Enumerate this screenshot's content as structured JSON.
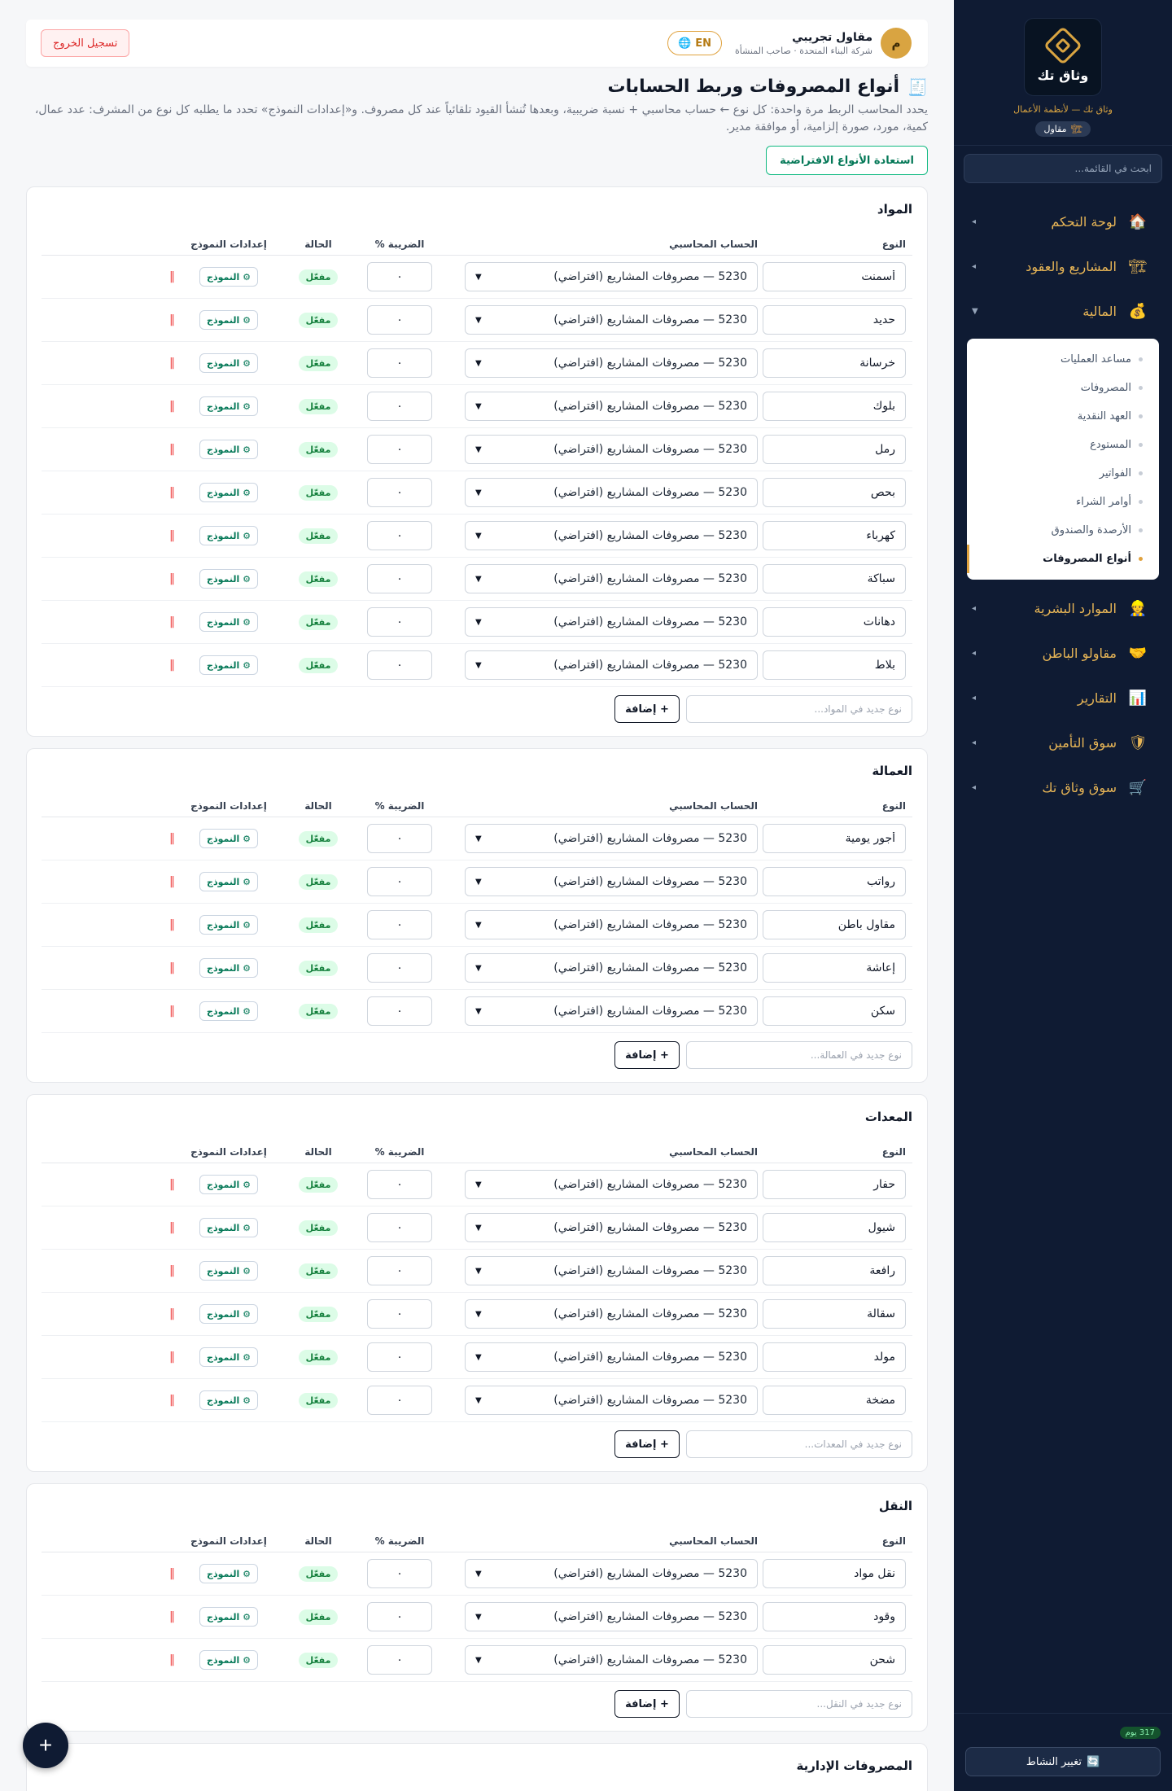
{
  "sidebar": {
    "logo_name": "وثاق تك",
    "tagline": "وثاق تك — لأنظمة الأعمال",
    "role": "مقاول",
    "search_placeholder": "ابحث في القائمة...",
    "nav": [
      {
        "label": "لوحة التحكم",
        "icon": "🏠"
      },
      {
        "label": "المشاريع والعقود",
        "icon": "🏗"
      },
      {
        "label": "المالية",
        "icon": "💰",
        "expanded": true
      },
      {
        "label": "الموارد البشرية",
        "icon": "👷"
      },
      {
        "label": "مقاولو الباطن",
        "icon": "🤝"
      },
      {
        "label": "التقارير",
        "icon": "📊"
      },
      {
        "label": "سوق التأمين",
        "icon": "🛡"
      },
      {
        "label": "سوق وثاق تك",
        "icon": "🛒"
      }
    ],
    "finance_sub": [
      "مساعد العمليات",
      "المصروفات",
      "العهد النقدية",
      "المستودع",
      "الفواتير",
      "أوامر الشراء",
      "الأرصدة والصندوق",
      "أنواع المصروفات"
    ],
    "days": "317 يوم",
    "activity_button": "تغيير النشاط"
  },
  "header": {
    "lang": "EN",
    "avatar": "م",
    "user_name": "مقاول تجريبي",
    "company": "شركة البناء المتحدة · صاحب المنشأة",
    "logout": "تسجيل الخروج"
  },
  "page": {
    "title": "أنواع المصروفات وربط الحسابات",
    "description": "يحدد المحاسب الربط مرة واحدة: كل نوع ← حساب محاسبي + نسبة ضريبية، وبعدها تُنشأ القيود تلقائياً عند كل مصروف. و«إعدادات النموذج» تحدد ما يطلبه كل نوع من المشرف: عدد عمال، كمية، مورد، صورة إلزامية، أو موافقة مدير.",
    "restore_button": "استعادة الأنواع الافتراضية"
  },
  "columns": {
    "type": "النوع",
    "account": "الحساب المحاسبي",
    "tax": "الضريبة %",
    "status": "الحالة",
    "model": "إعدادات النموذج"
  },
  "row_defaults": {
    "account": "5230 — مصروفات المشاريع (افتراضي)",
    "tax": "٠",
    "status": "مفعّل",
    "model_button": "⚙ النموذج",
    "add_button": "+ إضافة"
  },
  "sections": [
    {
      "title": "المواد",
      "add_placeholder": "نوع جديد في المواد...",
      "items": [
        "أسمنت",
        "حديد",
        "خرسانة",
        "بلوك",
        "رمل",
        "بحص",
        "كهرباء",
        "سباكة",
        "دهانات",
        "بلاط"
      ]
    },
    {
      "title": "العمالة",
      "add_placeholder": "نوع جديد في العمالة...",
      "items": [
        "أجور يومية",
        "رواتب",
        "مقاول باطن",
        "إعاشة",
        "سكن"
      ]
    },
    {
      "title": "المعدات",
      "add_placeholder": "نوع جديد في المعدات...",
      "items": [
        "حفار",
        "شيول",
        "رافعة",
        "سقالة",
        "مولد",
        "مضخة"
      ]
    },
    {
      "title": "النقل",
      "add_placeholder": "نوع جديد في النقل...",
      "items": [
        "نقل مواد",
        "وقود",
        "شحن"
      ]
    }
  ],
  "partial_section": {
    "title": "المصروفات الإدارية"
  },
  "fab": "+",
  "colors": {
    "sidebar_bg": "#0f1b33",
    "accent": "#e0a23e",
    "success": "#15803d",
    "danger": "#ef4444"
  }
}
